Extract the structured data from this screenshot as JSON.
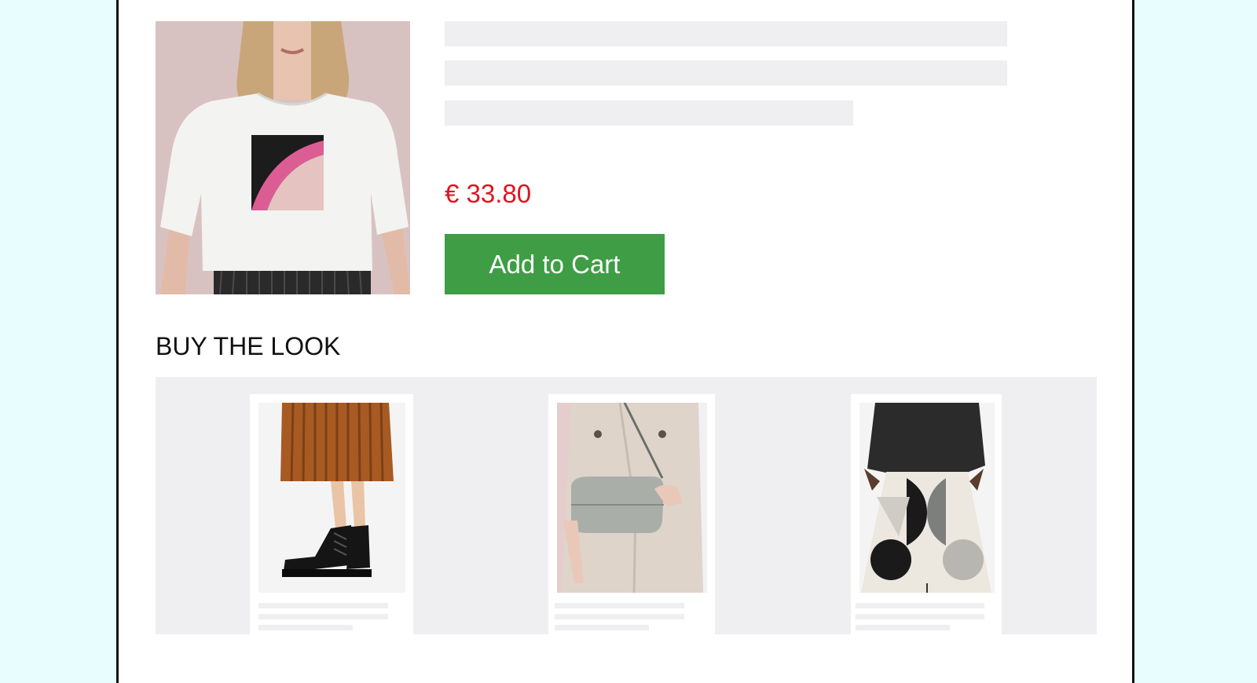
{
  "product": {
    "image_alt": "Woman wearing white t-shirt with pink arc print",
    "price": "€ 33.80",
    "add_to_cart_label": "Add to Cart"
  },
  "buy_the_look": {
    "title": "BUY THE LOOK",
    "items": [
      {
        "image_alt": "Rust pleated skirt with black lace-up boots"
      },
      {
        "image_alt": "Beige trench coat with grey crossbody bag"
      },
      {
        "image_alt": "Black blouse with wide graphic-print trousers"
      }
    ]
  },
  "colors": {
    "background": "#e8fdfe",
    "price": "#e0141f",
    "cta": "#3e9d45",
    "skeleton": "#efeef0"
  }
}
